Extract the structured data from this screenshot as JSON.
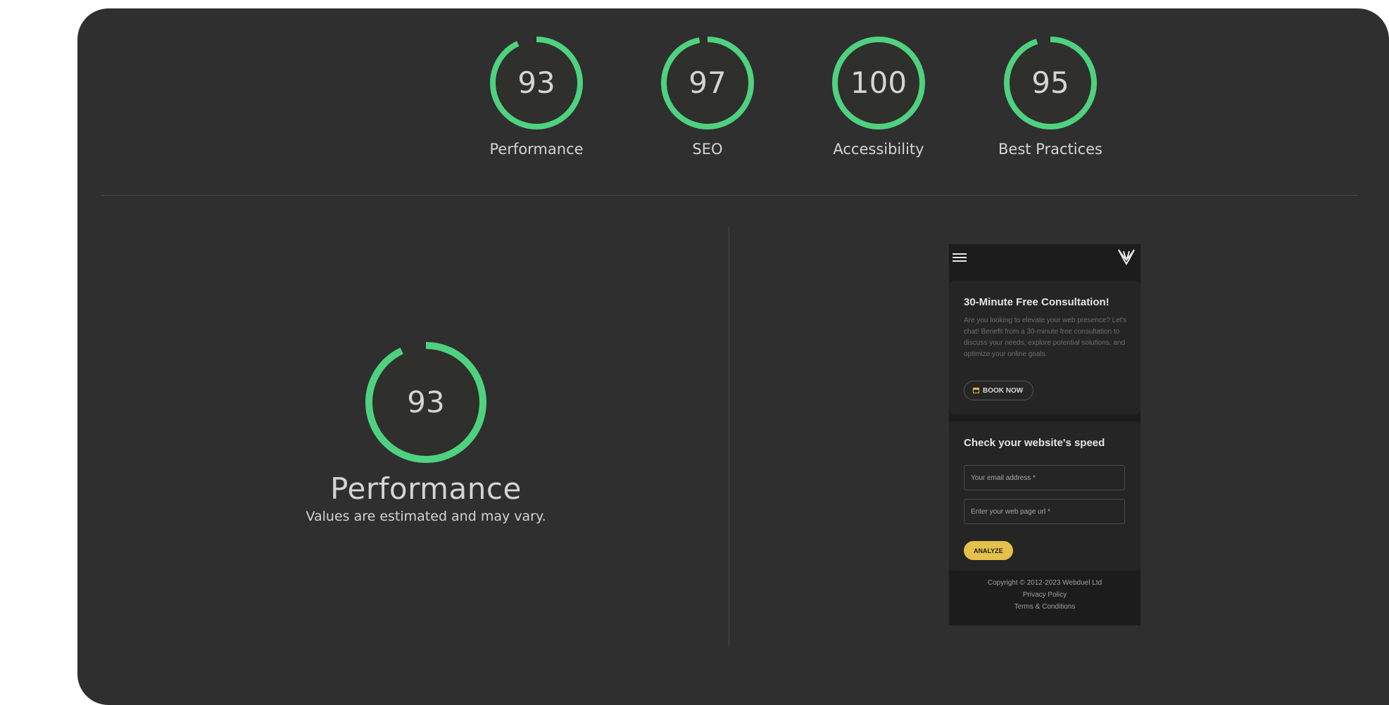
{
  "colors": {
    "panel_bg": "#2f2f30",
    "gauge_green": "#4fd27f",
    "accent_yellow": "#e3c14a"
  },
  "scores": [
    {
      "label": "Performance",
      "value": "93",
      "fraction": 0.93
    },
    {
      "label": "SEO",
      "value": "97",
      "fraction": 0.97
    },
    {
      "label": "Accessibility",
      "value": "100",
      "fraction": 1.0
    },
    {
      "label": "Best Practices",
      "value": "95",
      "fraction": 0.95
    }
  ],
  "main": {
    "score": "93",
    "fraction": 0.93,
    "title": "Performance",
    "subtitle": "Values are estimated and may vary."
  },
  "phone": {
    "menu_icon": "hamburger-icon",
    "logo_icon": "webduel-logo-icon",
    "consult": {
      "title": "30-Minute Free Consultation!",
      "body": "Are you looking to elevate your web presence? Let's chat! Benefit from a 30-minute free consultation to discuss your needs, explore potential solutions, and optimize your online goals.",
      "button": "BOOK NOW",
      "button_icon": "calendar-icon"
    },
    "speed": {
      "title": "Check your website's speed",
      "email_placeholder": "Your email address *",
      "url_placeholder": "Enter your web page url *",
      "button": "ANALYZE"
    },
    "footer": {
      "copyright": "Copyright © 2012-2023 Webduel Ltd",
      "privacy": "Privacy Policy",
      "terms": "Terms & Conditions"
    }
  }
}
